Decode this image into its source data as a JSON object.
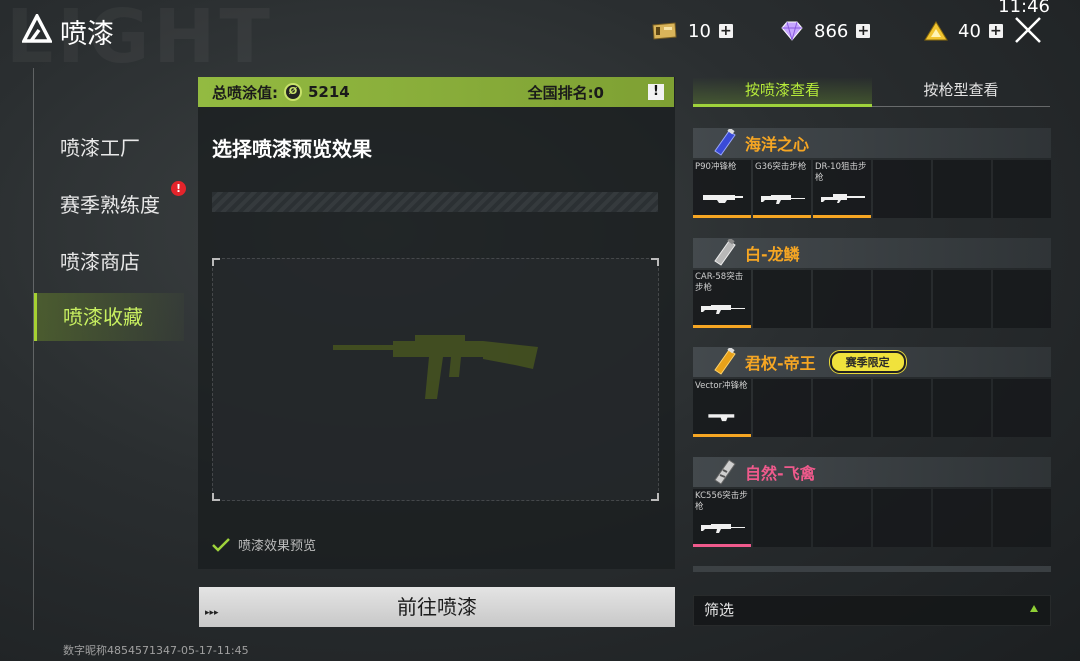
{
  "window": {
    "title": "喷漆",
    "clock": "11:46",
    "watermark": "LIGHT"
  },
  "currencies": [
    {
      "icon": "ticket-icon",
      "value": "10"
    },
    {
      "icon": "diamond-icon",
      "value": "866"
    },
    {
      "icon": "triangle-coin-icon",
      "value": "40"
    }
  ],
  "sidebar": {
    "items": [
      {
        "label": "喷漆工厂",
        "active": false
      },
      {
        "label": "赛季熟练度",
        "active": false,
        "badge": "!"
      },
      {
        "label": "喷漆商店",
        "active": false
      },
      {
        "label": "喷漆收藏",
        "active": true
      }
    ]
  },
  "score": {
    "label": "总喷涂值:",
    "value": "5214",
    "rank": "全国排名:0",
    "info": "!"
  },
  "preview": {
    "title": "选择喷漆预览效果",
    "checkbox_label": "喷漆效果预览",
    "checked": true
  },
  "go_button": {
    "label": "前往喷漆"
  },
  "tabs": [
    {
      "label": "按喷漆查看",
      "active": true
    },
    {
      "label": "按枪型查看",
      "active": false
    }
  ],
  "collections": [
    {
      "name": "海洋之心",
      "color": "#f6a623",
      "cells": [
        {
          "label": "P90冲锋枪",
          "accent": "#f6a623"
        },
        {
          "label": "G36突击步枪",
          "accent": "#f6a623"
        },
        {
          "label": "DR-10狙击步枪",
          "accent": "#f6a623"
        },
        {
          "label": "",
          "accent": ""
        },
        {
          "label": "",
          "accent": ""
        },
        {
          "label": "",
          "accent": ""
        }
      ]
    },
    {
      "name": "白-龙鳞",
      "color": "#f6a623",
      "cells": [
        {
          "label": "CAR-58突击步枪",
          "accent": "#f6a623"
        },
        {
          "label": "",
          "accent": ""
        },
        {
          "label": "",
          "accent": ""
        },
        {
          "label": "",
          "accent": ""
        },
        {
          "label": "",
          "accent": ""
        },
        {
          "label": "",
          "accent": ""
        }
      ]
    },
    {
      "name": "君权-帝王",
      "color": "#f6a623",
      "tag": "赛季限定",
      "cells": [
        {
          "label": "Vector冲锋枪",
          "accent": "#f6a623"
        },
        {
          "label": "",
          "accent": ""
        },
        {
          "label": "",
          "accent": ""
        },
        {
          "label": "",
          "accent": ""
        },
        {
          "label": "",
          "accent": ""
        },
        {
          "label": "",
          "accent": ""
        }
      ]
    },
    {
      "name": "自然-飞禽",
      "color": "#ef5a8c",
      "cells": [
        {
          "label": "KC556突击步枪",
          "accent": "#ef5a8c"
        },
        {
          "label": "",
          "accent": ""
        },
        {
          "label": "",
          "accent": ""
        },
        {
          "label": "",
          "accent": ""
        },
        {
          "label": "",
          "accent": ""
        },
        {
          "label": "",
          "accent": ""
        }
      ]
    }
  ],
  "filter": {
    "label": "筛选"
  },
  "footer": {
    "text": "数字昵称4854571347-05-17-11:45"
  },
  "colors": {
    "accent": "#9fd33b",
    "score_bar": "#8bb23b",
    "orange": "#f6a623",
    "pink": "#ef5a8c"
  }
}
